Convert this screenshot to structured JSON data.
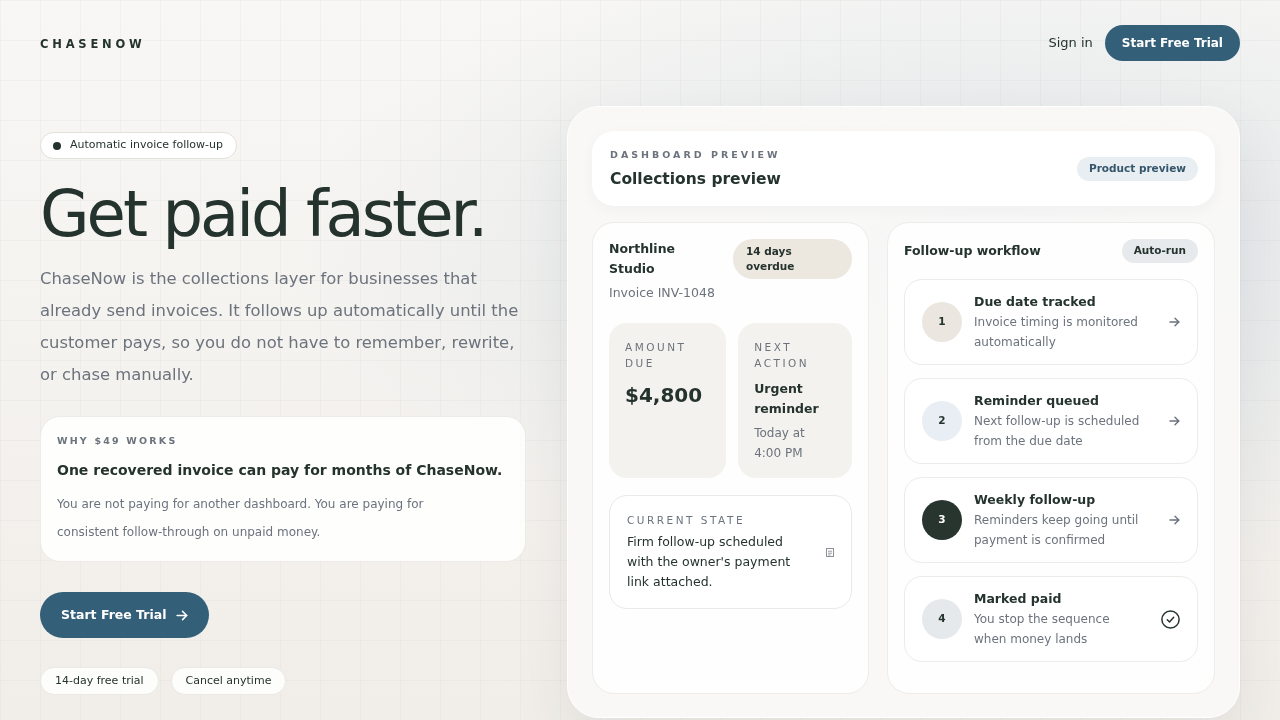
{
  "header": {
    "logo": "CHASENOW",
    "sign_in": "Sign in",
    "cta": "Start Free Trial"
  },
  "hero": {
    "tag": "Automatic invoice follow-up",
    "headline": "Get paid faster.",
    "description": "ChaseNow is the collections layer for businesses that already send invoices. It follows up automatically until the customer pays, so you do not have to remember, rewrite, or chase manually.",
    "value_card": {
      "eyebrow": "WHY $49 WORKS",
      "title": "One recovered invoice can pay for months of ChaseNow.",
      "text": "You are not paying for another dashboard. You are paying for consistent follow-through on unpaid money."
    },
    "cta": "Start Free Trial",
    "chips": [
      "14-day free trial",
      "Cancel anytime"
    ]
  },
  "dashboard": {
    "eyebrow": "DASHBOARD PREVIEW",
    "title": "Collections preview",
    "badge": "Product preview",
    "invoice": {
      "client": "Northline Studio",
      "status": "14 days overdue",
      "number": "Invoice INV-1048",
      "stats": [
        {
          "kind": "amount",
          "label": "AMOUNT DUE",
          "value": "$4,800"
        },
        {
          "kind": "action",
          "label": "NEXT ACTION",
          "value": "Urgent reminder",
          "detail": "Today at 4:00 PM"
        }
      ],
      "current_state": {
        "label": "CURRENT STATE",
        "text": "Firm follow-up scheduled with the owner's payment link attached."
      }
    },
    "workflow": {
      "title": "Follow-up workflow",
      "badge": "Auto-run",
      "steps": [
        {
          "number": "1",
          "title": "Due date tracked",
          "text": "Invoice timing is monitored automatically",
          "color": "#ebe6df",
          "complete": false
        },
        {
          "number": "2",
          "title": "Reminder queued",
          "text": "Next follow-up is scheduled from the due date",
          "color": "#e8eef3",
          "complete": false
        },
        {
          "number": "3",
          "title": "Weekly follow-up",
          "text": "Reminders keep going until payment is confirmed",
          "color": "#28352f",
          "complete": false
        },
        {
          "number": "4",
          "title": "Marked paid",
          "text": "You stop the sequence when money lands",
          "color": "#e5e9ec",
          "complete": true
        }
      ]
    }
  }
}
